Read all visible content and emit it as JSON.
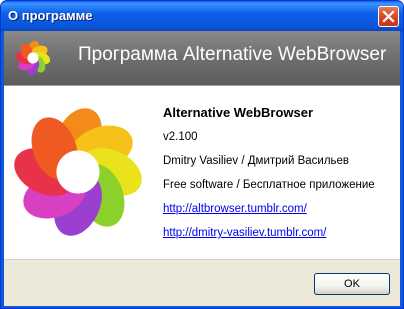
{
  "window": {
    "title": "О программе"
  },
  "header": {
    "title": "Программа Alternative WebBrowser"
  },
  "about": {
    "app_name": "Alternative WebBrowser",
    "version": "v2.100",
    "author": "Dmitry Vasiliev / Дмитрий Васильев",
    "license": "Free software / Бесплатное приложение",
    "link_blog": "http://altbrowser.tumblr.com/",
    "link_author": "http://dmitry-vasiliev.tumblr.com/"
  },
  "footer": {
    "ok_label": "OK"
  },
  "icons": {
    "close": "close-icon",
    "logo": "app-logo-icon"
  },
  "colors": {
    "titlebar": "#0853d8",
    "close_button": "#d8482a",
    "header_bg": "#6f6f6f",
    "link": "#0000ee",
    "footer_bg": "#ece9d8"
  }
}
